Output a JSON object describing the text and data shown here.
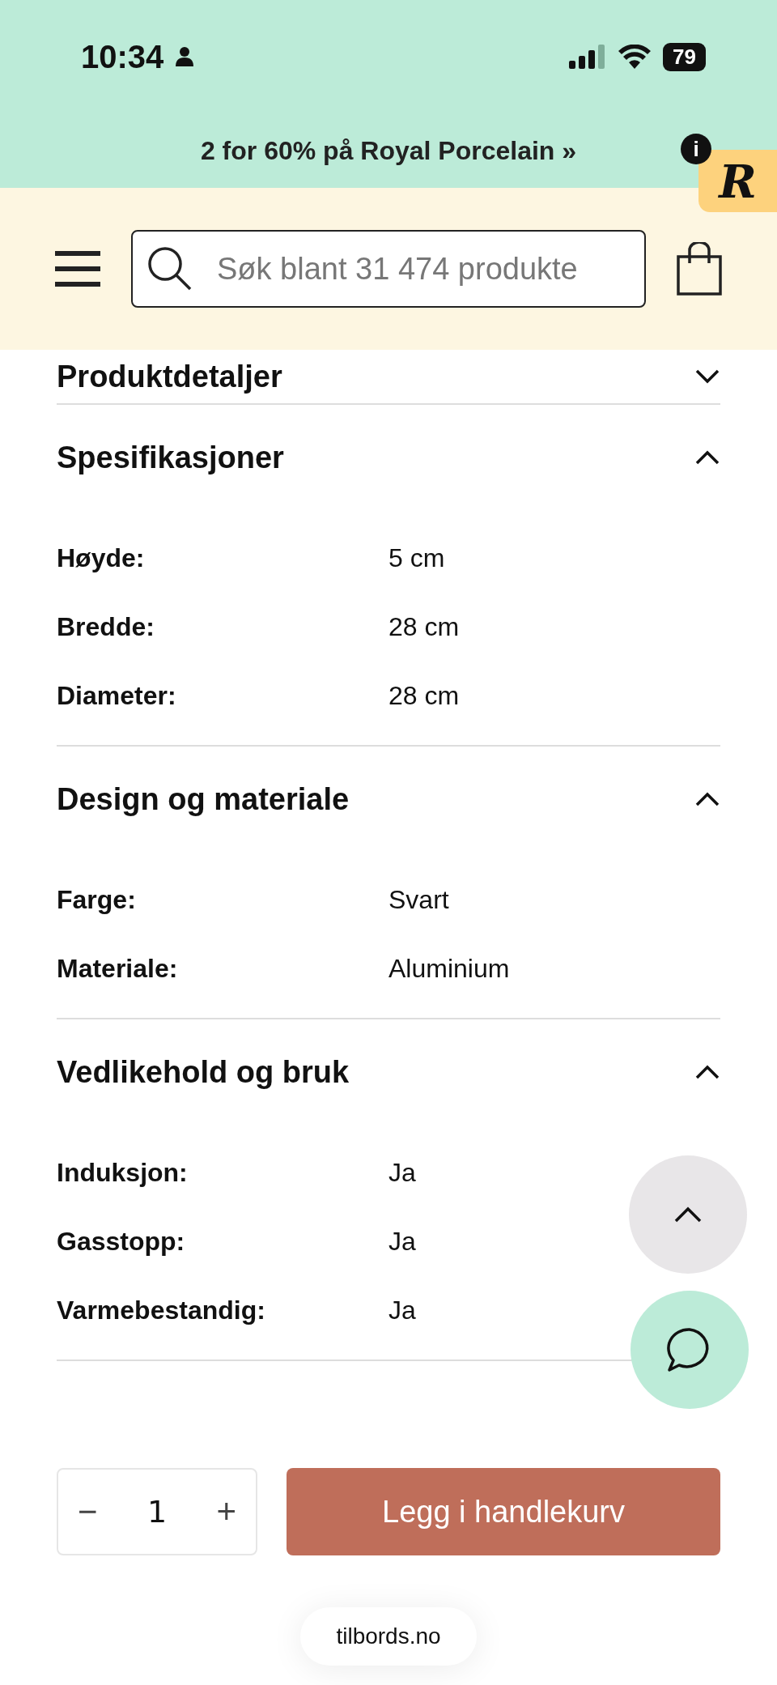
{
  "status_bar": {
    "time": "10:34",
    "battery": "79"
  },
  "promo": {
    "text": "2 for 60% på Royal Porcelain »",
    "badge_info": "i",
    "badge_letter": "R"
  },
  "search": {
    "placeholder": "Søk blant 31 474 produkte"
  },
  "sections": [
    {
      "title": "Produktdetaljer",
      "expanded": false
    },
    {
      "title": "Spesifikasjoner",
      "expanded": true,
      "rows": [
        {
          "label": "Høyde:",
          "value": "5 cm"
        },
        {
          "label": "Bredde:",
          "value": "28 cm"
        },
        {
          "label": "Diameter:",
          "value": "28 cm"
        }
      ]
    },
    {
      "title": "Design og materiale",
      "expanded": true,
      "rows": [
        {
          "label": "Farge:",
          "value": "Svart"
        },
        {
          "label": "Materiale:",
          "value": "Aluminium"
        }
      ]
    },
    {
      "title": "Vedlikehold og bruk",
      "expanded": true,
      "rows": [
        {
          "label": "Induksjon:",
          "value": "Ja"
        },
        {
          "label": "Gasstopp:",
          "value": "Ja"
        },
        {
          "label": "Varmebestandig:",
          "value": "Ja"
        }
      ]
    }
  ],
  "quantity": {
    "minus": "−",
    "value": "1",
    "plus": "+"
  },
  "add_button": "Legg i handlekurv",
  "url": "tilbords.no"
}
